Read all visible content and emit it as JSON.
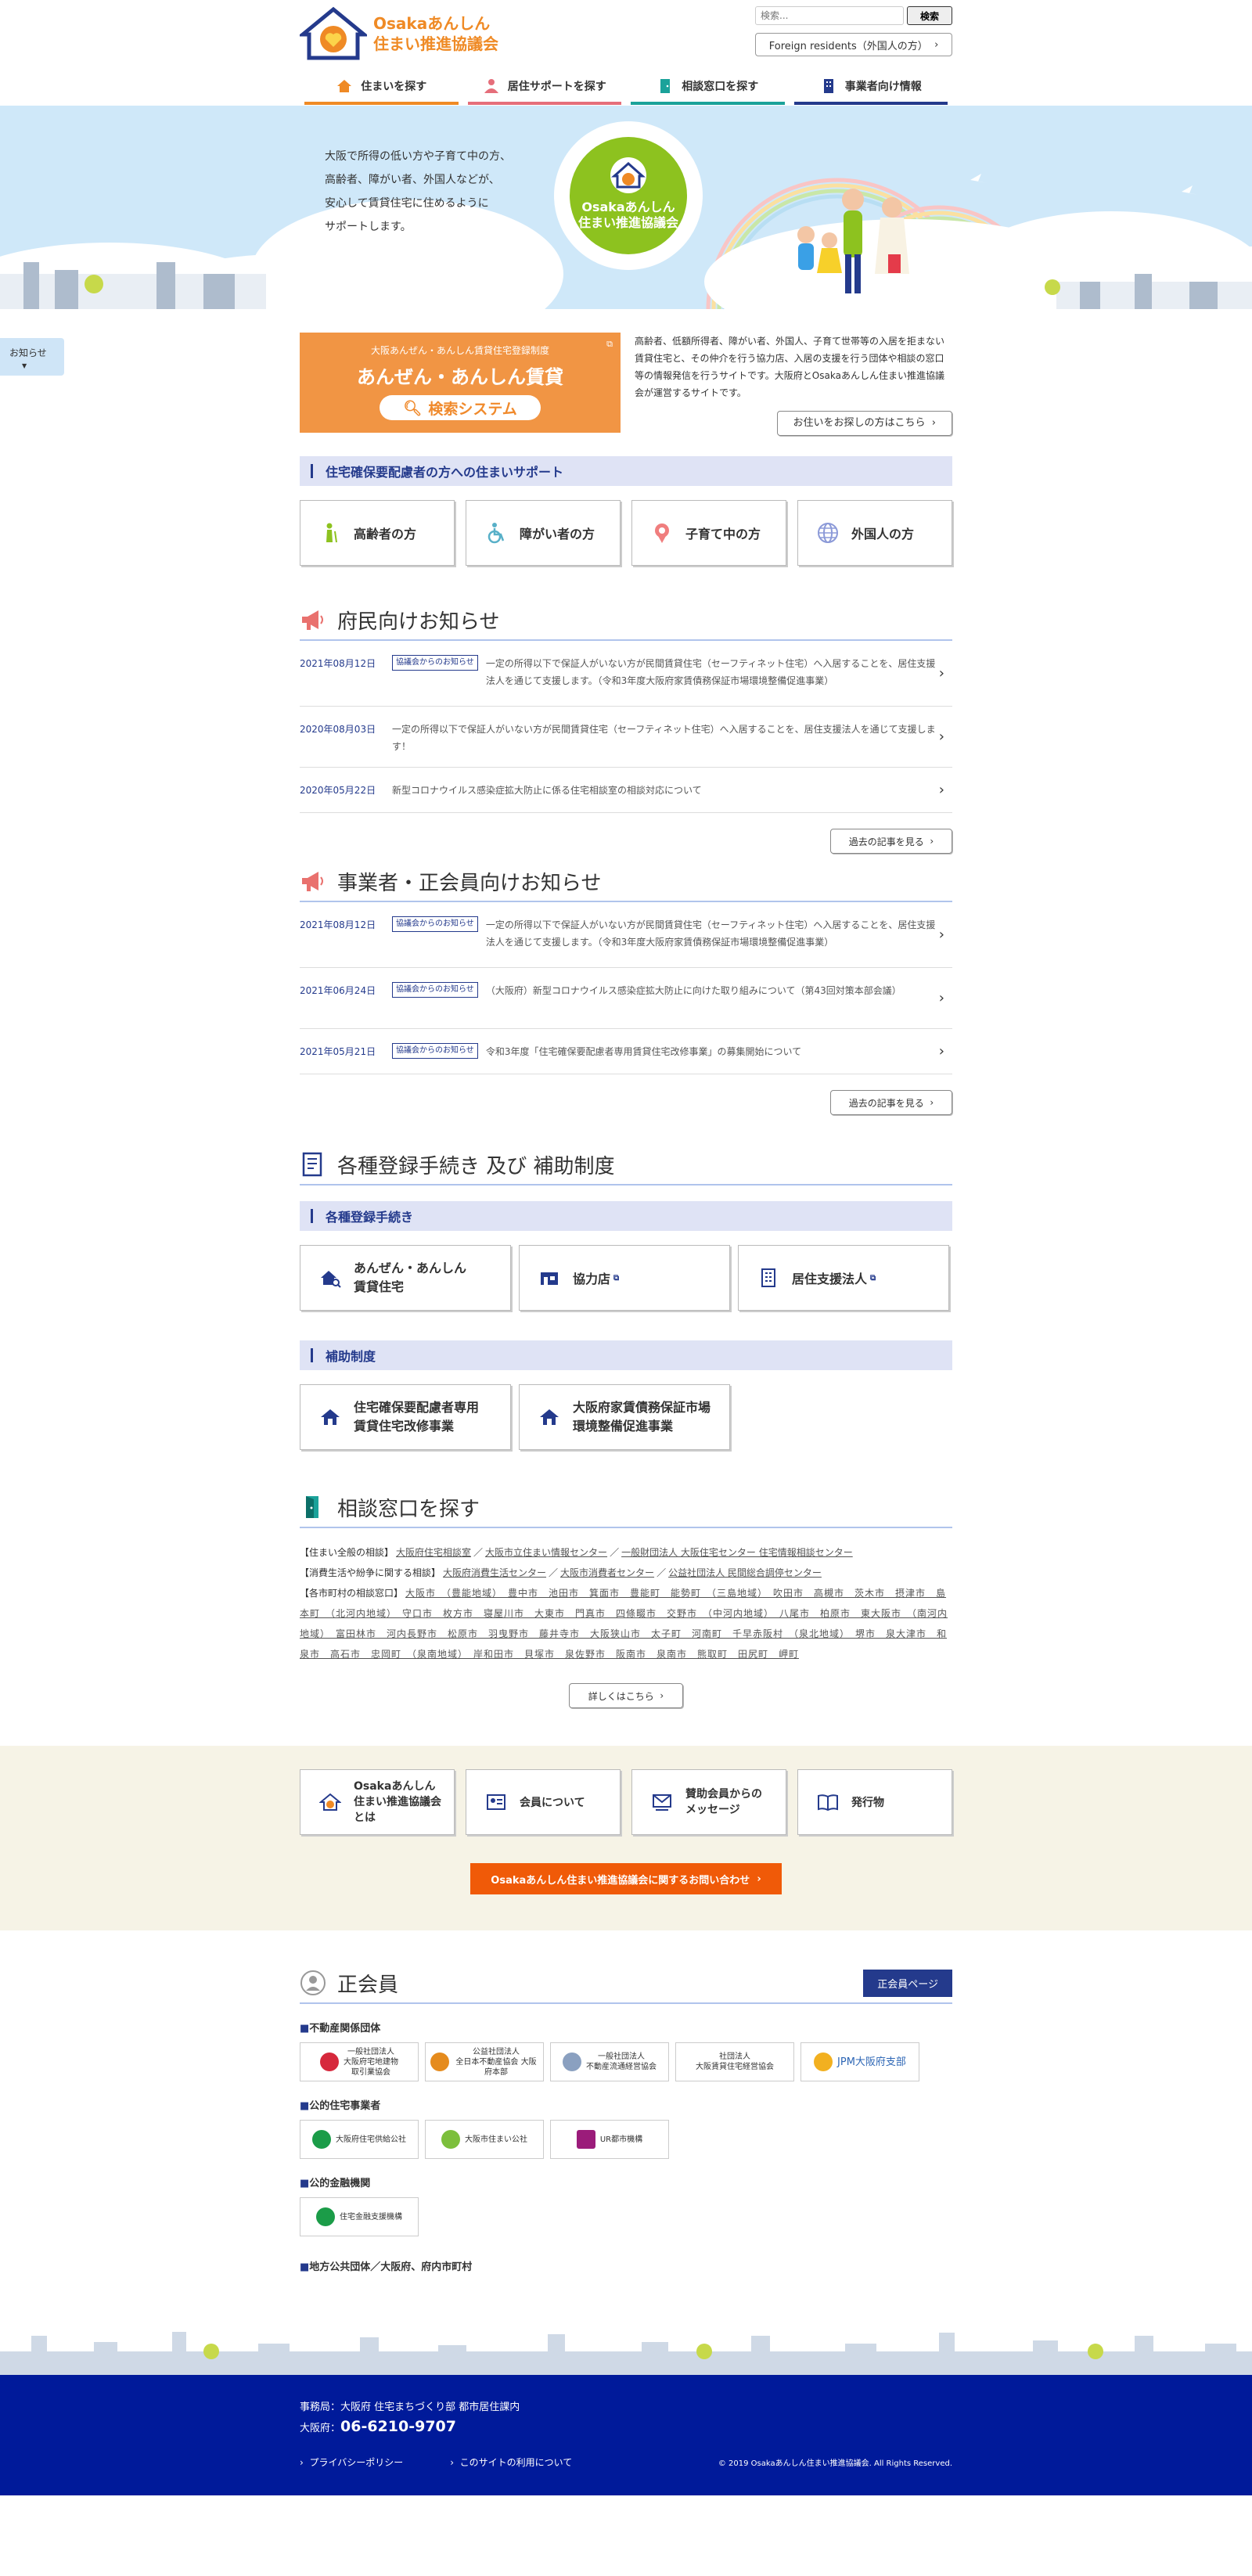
{
  "header": {
    "logo_line1": "Osakaあんしん",
    "logo_line2": "住まい推進協議会",
    "search_placeholder": "検索...",
    "search_button": "検索",
    "foreign": "Foreign residents（外国人の方）",
    "nav": [
      {
        "label": "住まいを探す",
        "color": "#ef8a25"
      },
      {
        "label": "居住サポートを探す",
        "color": "#e56e7a"
      },
      {
        "label": "相談窓口を探す",
        "color": "#1aa29a"
      },
      {
        "label": "事業者向け情報",
        "color": "#243a8c"
      }
    ]
  },
  "hero": {
    "lines": [
      "大阪で所得の低い方や子育て中の方、",
      "高齢者、障がい者、外国人などが、",
      "安心して賃貸住宅に住めるように",
      "サポートします。"
    ],
    "logo_line1": "Osakaあんしん",
    "logo_line2": "住まい推進協議会"
  },
  "side_tab": "お知らせ",
  "intro": {
    "banner_small": "大阪あんぜん・あんしん賃貸住宅登録制度",
    "banner_big": "あんぜん・あんしん賃貸",
    "banner_btn": "検索システム",
    "text": "高齢者、低額所得者、障がい者、外国人、子育て世帯等の入居を拒まない賃貸住宅と、その仲介を行う協力店、入居の支援を行う団体や相談の窓口等の情報発信を行うサイトです。大阪府とOsakaあんしん住まい推進協議会が運営するサイトです。",
    "btn": "お住いをお探しの方はこちら"
  },
  "support": {
    "title": "住宅確保要配慮者の方への住まいサポート",
    "cards": [
      "高齢者の方",
      "障がい者の方",
      "子育て中の方",
      "外国人の方"
    ]
  },
  "news_public": {
    "title": "府民向けお知らせ",
    "items": [
      {
        "date": "2021年08月12日",
        "tag": "協議会からのお知らせ",
        "text": "一定の所得以下で保証人がいない方が民間賃貸住宅（セーフティネット住宅）へ入居することを、居住支援法人を通じて支援します。（令和3年度大阪府家賃債務保証市場環境整備促進事業）"
      },
      {
        "date": "2020年08月03日",
        "tag": "",
        "text": "一定の所得以下で保証人がいない方が民間賃貸住宅（セーフティネット住宅）へ入居することを、居住支援法人を通じて支援します！"
      },
      {
        "date": "2020年05月22日",
        "tag": "",
        "text": "新型コロナウイルス感染症拡大防止に係る住宅相談室の相談対応について"
      }
    ],
    "more": "過去の記事を見る"
  },
  "news_biz": {
    "title": "事業者・正会員向けお知らせ",
    "items": [
      {
        "date": "2021年08月12日",
        "tag": "協議会からのお知らせ",
        "text": "一定の所得以下で保証人がいない方が民間賃貸住宅（セーフティネット住宅）へ入居することを、居住支援法人を通じて支援します。（令和3年度大阪府家賃債務保証市場環境整備促進事業）"
      },
      {
        "date": "2021年06月24日",
        "tag": "協議会からのお知らせ",
        "text": "（大阪府）新型コロナウイルス感染症拡大防止に向けた取り組みについて（第43回対策本部会議）"
      },
      {
        "date": "2021年05月21日",
        "tag": "協議会からのお知らせ",
        "text": "令和3年度「住宅確保要配慮者専用賃貸住宅改修事業」の募集開始について"
      }
    ],
    "more": "過去の記事を見る"
  },
  "reg": {
    "title": "各種登録手続き 及び 補助制度",
    "sub1": "各種登録手続き",
    "cards1": [
      "あんぜん・あんしん\n賃貸住宅",
      "協力店",
      "居住支援法人"
    ],
    "sub2": "補助制度",
    "cards2": [
      "住宅確保要配慮者専用\n賃貸住宅改修事業",
      "大阪府家賃債務保証市場\n環境整備促進事業"
    ]
  },
  "soudan": {
    "title": "相談窓口を探す",
    "row1_label": "【住まい全般の相談】",
    "row1": [
      "大阪府住宅相談室",
      "大阪市立住まい情報センター",
      "一般財団法人 大阪住宅センター 住宅情報相談センター"
    ],
    "row2_label": "【消費生活や紛争に関する相談】",
    "row2": [
      "大阪府消費生活センター",
      "大阪市消費者センター",
      "公益社団法人 民間総合調停センター"
    ],
    "row3_label": "【各市町村の相談窓口】",
    "row3": "大阪市　（豊能地域）　豊中市　池田市　箕面市　豊能町　能勢町　（三島地域）　吹田市　高槻市　茨木市　摂津市　島本町　（北河内地域）　守口市　枚方市　寝屋川市　大東市　門真市　四條畷市　交野市　（中河内地域）　八尾市　柏原市　東大阪市　（南河内地域）　富田林市　河内長野市　松原市　羽曳野市　藤井寺市　大阪狭山市　太子町　河南町　千早赤阪村　（泉北地域）　堺市　泉大津市　和泉市　高石市　忠岡町　（泉南地域）　岸和田市　貝塚市　泉佐野市　阪南市　泉南市　熊取町　田尻町　岬町",
    "more": "詳しくはこちら"
  },
  "about": {
    "cards": [
      "Osakaあんしん\n住まい推進協議会\nとは",
      "会員について",
      "賛助会員からの\nメッセージ",
      "発行物"
    ],
    "contact": "Osakaあんしん住まい推進協議会に関するお問い合わせ"
  },
  "members": {
    "title": "正会員",
    "page_btn": "正会員ページ",
    "groups": [
      {
        "label": "不動産関係団体",
        "logos": [
          "一般社団法人\n大阪府宅地建物\n取引業協会",
          "公益社団法人\n全日本不動産協会 大阪府本部",
          "一般社団法人\n不動産流通経営協会",
          "社団法人\n大阪賃貸住宅経営協会",
          "JPM大阪府支部"
        ]
      },
      {
        "label": "公的住宅事業者",
        "logos": [
          "大阪府住宅供給公社",
          "大阪市住まい公社",
          "UR都市機構"
        ]
      },
      {
        "label": "公的金融機関",
        "logos": [
          "住宅金融支援機構"
        ]
      },
      {
        "label": "地方公共団体／大阪府、府内市町村",
        "logos": []
      }
    ]
  },
  "footer": {
    "address": "事務局：大阪府 住宅まちづくり部 都市居住課内",
    "tel_label": "大阪府：",
    "tel": "06-6210-9707",
    "links": [
      "プライバシーポリシー",
      "このサイトの利用について"
    ],
    "copyright": "© 2019 Osakaあんしん住まい推進協議会. All Rights Reserved."
  }
}
